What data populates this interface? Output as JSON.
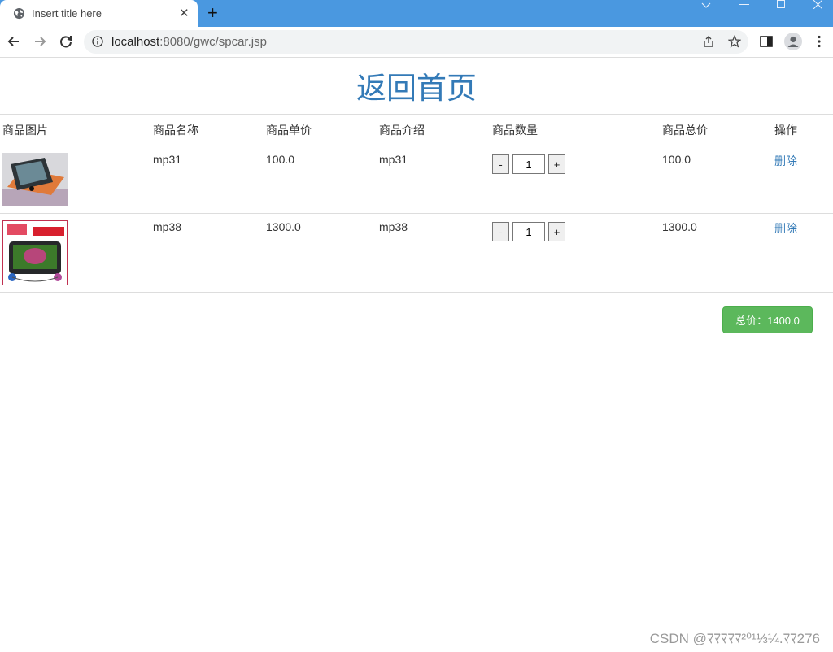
{
  "browser": {
    "tab_title": "Insert title here",
    "tab_close": "✕",
    "new_tab": "+",
    "url_host": "localhost",
    "url_rest": ":8080/gwc/spcar.jsp"
  },
  "page": {
    "home_link": "返回首页",
    "headers": [
      "商品图片",
      "商品名称",
      "商品单价",
      "商品介绍",
      "商品数量",
      "商品总价",
      "操作"
    ],
    "rows": [
      {
        "name": "mp31",
        "price": "100.0",
        "intro": "mp31",
        "quantity": "1",
        "total": "100.0",
        "action": "删除"
      },
      {
        "name": "mp38",
        "price": "1300.0",
        "intro": "mp38",
        "quantity": "1",
        "total": "1300.0",
        "action": "删除"
      }
    ],
    "minus": "-",
    "plus": "+",
    "grand_total": "总价：1400.0",
    "watermark": "CSDN @ﾏﾏﾏﾏﾏ²⁰¹⅓¼.ﾏﾏ276"
  }
}
